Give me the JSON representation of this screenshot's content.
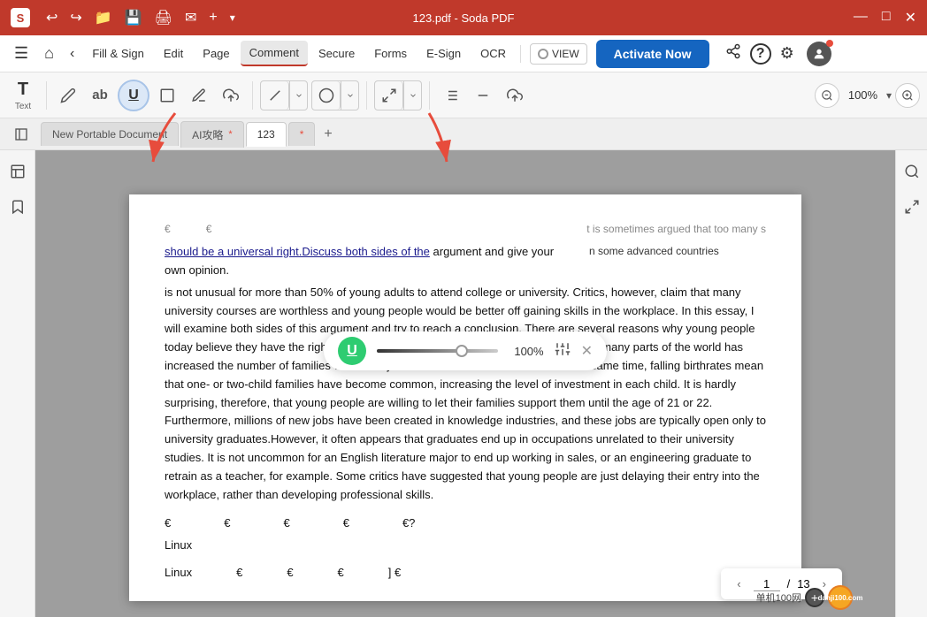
{
  "titleBar": {
    "appIcon": "S",
    "title": "123.pdf  -  Soda PDF",
    "toolbarIcons": [
      "↩",
      "↪",
      "📁",
      "💾",
      "🖨",
      "✉",
      "+",
      "▾"
    ]
  },
  "menuBar": {
    "hamburger": "☰",
    "home": "⌂",
    "back": "‹",
    "items": [
      {
        "label": "Fill & Sign",
        "active": false
      },
      {
        "label": "Edit",
        "active": false
      },
      {
        "label": "Page",
        "active": false
      },
      {
        "label": "Comment",
        "active": true
      },
      {
        "label": "Secure",
        "active": false
      },
      {
        "label": "Forms",
        "active": false
      },
      {
        "label": "E-Sign",
        "active": false
      },
      {
        "label": "OCR",
        "active": false
      }
    ],
    "viewToggle": "VIEW",
    "activateBtn": "Activate Now",
    "shareIcon": "⬆",
    "helpIcon": "?",
    "settingsIcon": "⚙"
  },
  "toolbar": {
    "textTool": {
      "label": "Text",
      "icon": "T"
    },
    "tools": [
      {
        "name": "pencil",
        "icon": "✏"
      },
      {
        "name": "strikethrough",
        "icon": "ab̶"
      },
      {
        "name": "underline",
        "icon": "U̲",
        "active": true
      },
      {
        "name": "rectangle",
        "icon": "□"
      },
      {
        "name": "highlight",
        "icon": "✏"
      },
      {
        "name": "stamp",
        "icon": "⬆"
      },
      {
        "name": "line",
        "icon": "/"
      },
      {
        "name": "ellipse",
        "icon": "○"
      },
      {
        "name": "arrow-expand",
        "icon": "↗"
      },
      {
        "name": "text-comment",
        "icon": "T̲"
      },
      {
        "name": "note",
        "icon": "—"
      },
      {
        "name": "attach",
        "icon": "⬆"
      }
    ],
    "zoom": {
      "minus": "−",
      "value": "100%",
      "plus": "+"
    }
  },
  "tabs": [
    {
      "label": "New Portable Document",
      "active": false,
      "closeable": false
    },
    {
      "label": "AI攻略",
      "active": false,
      "closeable": false
    },
    {
      "label": "123",
      "active": true,
      "closeable": false
    },
    {
      "label": "",
      "active": false,
      "closeable": false
    }
  ],
  "underlineToolbar": {
    "icon": "U",
    "opacityValue": "100%",
    "adjustIcon": "⚙",
    "closeIcon": "✕"
  },
  "pdfContent": {
    "underlinedText": "should be a universal right.Discuss both sides of the",
    "paragraph1": "argument and give your own opinion.",
    "bodyText": "is not unusual for more than 50% of young adults to attend college or university. Critics, however, claim that many university courses are worthless and young people would be better off gaining skills in the workplace. In this essay, I will examine both sides of this argument and try to reach a conclusion. There are several reasons why young people today believe they have the right to a university education. First, growing prosperity in many parts of the world has increased the number of families with money to invest in their children   future. At the same time, falling birthrates mean that one- or two-child families have become common, increasing the level of investment in each child. It is hardly surprising, therefore, that young people are willing to let their families support them until the age of 21 or 22. Furthermore, millions of new jobs have been created in knowledge industries, and these jobs are typically open only to university graduates.However, it often appears that graduates end up in occupations unrelated to their university studies. It is not uncommon for an English literature major to end up working in sales, or an engineering graduate to retrain as a teacher, for example. Some critics have suggested that young people are just delaying their entry into the workplace, rather than developing professional skills.",
    "linux1": "Linux",
    "linux2": "Linux",
    "partial1": "t is sometimes argued that too many s",
    "partial2": "n some advanced countries"
  },
  "pagination": {
    "currentPage": "1",
    "totalPages": "13",
    "prevIcon": "‹",
    "nextIcon": "›"
  },
  "bottomLogo": {
    "siteText": "单机100网",
    "url": "danji100.com"
  }
}
